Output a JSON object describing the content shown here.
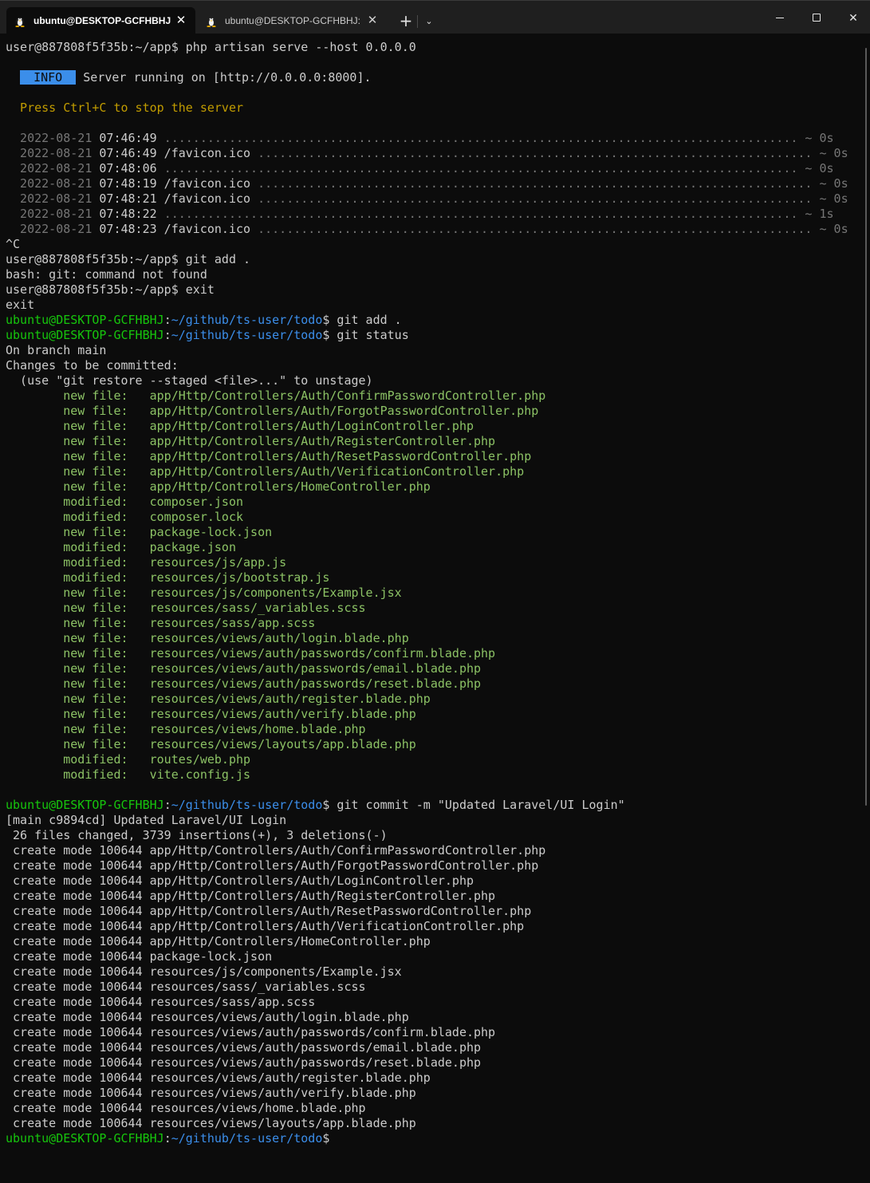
{
  "tabs": [
    {
      "title": "ubuntu@DESKTOP-GCFHBHJ:",
      "icon": "tux-icon",
      "active": true
    },
    {
      "title": "ubuntu@DESKTOP-GCFHBHJ: -",
      "icon": "tux-icon",
      "active": false
    }
  ],
  "titlebar": {
    "new_tab": "+",
    "dropdown": "⌄",
    "close_tab": "✕",
    "window_close": "✕"
  },
  "colors": {
    "background": "#0c0c0c",
    "prompt_green": "#16c60c",
    "path_blue": "#3b8eea",
    "git_green": "#8cc265",
    "warning_yellow": "#c19c00",
    "info_badge": "#3b8eea"
  },
  "terminal": {
    "lines": [
      [
        {
          "t": "user@887808f5f35b:~/app$ php artisan serve --host 0.0.0.0",
          "c": "default"
        }
      ],
      [
        {
          "t": "",
          "c": "default"
        }
      ],
      [
        {
          "t": "  ",
          "c": "default"
        },
        {
          "t": " INFO ",
          "c": "badge"
        },
        {
          "t": " Server running on [http://0.0.0.0:8000].",
          "c": "default"
        }
      ],
      [
        {
          "t": "",
          "c": "default"
        }
      ],
      [
        {
          "t": "  Press Ctrl+C to stop the server",
          "c": "yellow"
        }
      ],
      [
        {
          "t": "",
          "c": "default"
        }
      ],
      [
        {
          "t": "  2022-08-21 ",
          "c": "gray"
        },
        {
          "t": "07:46:49 ",
          "c": "default"
        },
        {
          "t": "........................................................................................ ~ 0s",
          "c": "gray"
        }
      ],
      [
        {
          "t": "  2022-08-21 ",
          "c": "gray"
        },
        {
          "t": "07:46:49 /favicon.ico ",
          "c": "default"
        },
        {
          "t": "............................................................................. ~ 0s",
          "c": "gray"
        }
      ],
      [
        {
          "t": "  2022-08-21 ",
          "c": "gray"
        },
        {
          "t": "07:48:06 ",
          "c": "default"
        },
        {
          "t": "........................................................................................ ~ 0s",
          "c": "gray"
        }
      ],
      [
        {
          "t": "  2022-08-21 ",
          "c": "gray"
        },
        {
          "t": "07:48:19 /favicon.ico ",
          "c": "default"
        },
        {
          "t": "............................................................................. ~ 0s",
          "c": "gray"
        }
      ],
      [
        {
          "t": "  2022-08-21 ",
          "c": "gray"
        },
        {
          "t": "07:48:21 /favicon.ico ",
          "c": "default"
        },
        {
          "t": "............................................................................. ~ 0s",
          "c": "gray"
        }
      ],
      [
        {
          "t": "  2022-08-21 ",
          "c": "gray"
        },
        {
          "t": "07:48:22 ",
          "c": "default"
        },
        {
          "t": "........................................................................................ ~ 1s",
          "c": "gray"
        }
      ],
      [
        {
          "t": "  2022-08-21 ",
          "c": "gray"
        },
        {
          "t": "07:48:23 /favicon.ico ",
          "c": "default"
        },
        {
          "t": "............................................................................. ~ 0s",
          "c": "gray"
        }
      ],
      [
        {
          "t": "^C",
          "c": "default"
        }
      ],
      [
        {
          "t": "user@887808f5f35b:~/app$ git add .",
          "c": "default"
        }
      ],
      [
        {
          "t": "bash: git: command not found",
          "c": "default"
        }
      ],
      [
        {
          "t": "user@887808f5f35b:~/app$ exit",
          "c": "default"
        }
      ],
      [
        {
          "t": "exit",
          "c": "default"
        }
      ],
      [
        {
          "t": "ubuntu@DESKTOP-GCFHBHJ",
          "c": "prompt"
        },
        {
          "t": ":",
          "c": "default"
        },
        {
          "t": "~/github/ts-user/todo",
          "c": "path"
        },
        {
          "t": "$ git add .",
          "c": "default"
        }
      ],
      [
        {
          "t": "ubuntu@DESKTOP-GCFHBHJ",
          "c": "prompt"
        },
        {
          "t": ":",
          "c": "default"
        },
        {
          "t": "~/github/ts-user/todo",
          "c": "path"
        },
        {
          "t": "$ git status",
          "c": "default"
        }
      ],
      [
        {
          "t": "On branch main",
          "c": "default"
        }
      ],
      [
        {
          "t": "Changes to be committed:",
          "c": "default"
        }
      ],
      [
        {
          "t": "  (use \"git restore --staged <file>...\" to unstage)",
          "c": "default"
        }
      ],
      [
        {
          "t": "        new file:   app/Http/Controllers/Auth/ConfirmPasswordController.php",
          "c": "git"
        }
      ],
      [
        {
          "t": "        new file:   app/Http/Controllers/Auth/ForgotPasswordController.php",
          "c": "git"
        }
      ],
      [
        {
          "t": "        new file:   app/Http/Controllers/Auth/LoginController.php",
          "c": "git"
        }
      ],
      [
        {
          "t": "        new file:   app/Http/Controllers/Auth/RegisterController.php",
          "c": "git"
        }
      ],
      [
        {
          "t": "        new file:   app/Http/Controllers/Auth/ResetPasswordController.php",
          "c": "git"
        }
      ],
      [
        {
          "t": "        new file:   app/Http/Controllers/Auth/VerificationController.php",
          "c": "git"
        }
      ],
      [
        {
          "t": "        new file:   app/Http/Controllers/HomeController.php",
          "c": "git"
        }
      ],
      [
        {
          "t": "        modified:   composer.json",
          "c": "git"
        }
      ],
      [
        {
          "t": "        modified:   composer.lock",
          "c": "git"
        }
      ],
      [
        {
          "t": "        new file:   package-lock.json",
          "c": "git"
        }
      ],
      [
        {
          "t": "        modified:   package.json",
          "c": "git"
        }
      ],
      [
        {
          "t": "        modified:   resources/js/app.js",
          "c": "git"
        }
      ],
      [
        {
          "t": "        modified:   resources/js/bootstrap.js",
          "c": "git"
        }
      ],
      [
        {
          "t": "        new file:   resources/js/components/Example.jsx",
          "c": "git"
        }
      ],
      [
        {
          "t": "        new file:   resources/sass/_variables.scss",
          "c": "git"
        }
      ],
      [
        {
          "t": "        new file:   resources/sass/app.scss",
          "c": "git"
        }
      ],
      [
        {
          "t": "        new file:   resources/views/auth/login.blade.php",
          "c": "git"
        }
      ],
      [
        {
          "t": "        new file:   resources/views/auth/passwords/confirm.blade.php",
          "c": "git"
        }
      ],
      [
        {
          "t": "        new file:   resources/views/auth/passwords/email.blade.php",
          "c": "git"
        }
      ],
      [
        {
          "t": "        new file:   resources/views/auth/passwords/reset.blade.php",
          "c": "git"
        }
      ],
      [
        {
          "t": "        new file:   resources/views/auth/register.blade.php",
          "c": "git"
        }
      ],
      [
        {
          "t": "        new file:   resources/views/auth/verify.blade.php",
          "c": "git"
        }
      ],
      [
        {
          "t": "        new file:   resources/views/home.blade.php",
          "c": "git"
        }
      ],
      [
        {
          "t": "        new file:   resources/views/layouts/app.blade.php",
          "c": "git"
        }
      ],
      [
        {
          "t": "        modified:   routes/web.php",
          "c": "git"
        }
      ],
      [
        {
          "t": "        modified:   vite.config.js",
          "c": "git"
        }
      ],
      [
        {
          "t": "",
          "c": "default"
        }
      ],
      [
        {
          "t": "ubuntu@DESKTOP-GCFHBHJ",
          "c": "prompt"
        },
        {
          "t": ":",
          "c": "default"
        },
        {
          "t": "~/github/ts-user/todo",
          "c": "path"
        },
        {
          "t": "$ git commit -m \"Updated Laravel/UI Login\"",
          "c": "default"
        }
      ],
      [
        {
          "t": "[main c9894cd] Updated Laravel/UI Login",
          "c": "default"
        }
      ],
      [
        {
          "t": " 26 files changed, 3739 insertions(+), 3 deletions(-)",
          "c": "default"
        }
      ],
      [
        {
          "t": " create mode 100644 app/Http/Controllers/Auth/ConfirmPasswordController.php",
          "c": "default"
        }
      ],
      [
        {
          "t": " create mode 100644 app/Http/Controllers/Auth/ForgotPasswordController.php",
          "c": "default"
        }
      ],
      [
        {
          "t": " create mode 100644 app/Http/Controllers/Auth/LoginController.php",
          "c": "default"
        }
      ],
      [
        {
          "t": " create mode 100644 app/Http/Controllers/Auth/RegisterController.php",
          "c": "default"
        }
      ],
      [
        {
          "t": " create mode 100644 app/Http/Controllers/Auth/ResetPasswordController.php",
          "c": "default"
        }
      ],
      [
        {
          "t": " create mode 100644 app/Http/Controllers/Auth/VerificationController.php",
          "c": "default"
        }
      ],
      [
        {
          "t": " create mode 100644 app/Http/Controllers/HomeController.php",
          "c": "default"
        }
      ],
      [
        {
          "t": " create mode 100644 package-lock.json",
          "c": "default"
        }
      ],
      [
        {
          "t": " create mode 100644 resources/js/components/Example.jsx",
          "c": "default"
        }
      ],
      [
        {
          "t": " create mode 100644 resources/sass/_variables.scss",
          "c": "default"
        }
      ],
      [
        {
          "t": " create mode 100644 resources/sass/app.scss",
          "c": "default"
        }
      ],
      [
        {
          "t": " create mode 100644 resources/views/auth/login.blade.php",
          "c": "default"
        }
      ],
      [
        {
          "t": " create mode 100644 resources/views/auth/passwords/confirm.blade.php",
          "c": "default"
        }
      ],
      [
        {
          "t": " create mode 100644 resources/views/auth/passwords/email.blade.php",
          "c": "default"
        }
      ],
      [
        {
          "t": " create mode 100644 resources/views/auth/passwords/reset.blade.php",
          "c": "default"
        }
      ],
      [
        {
          "t": " create mode 100644 resources/views/auth/register.blade.php",
          "c": "default"
        }
      ],
      [
        {
          "t": " create mode 100644 resources/views/auth/verify.blade.php",
          "c": "default"
        }
      ],
      [
        {
          "t": " create mode 100644 resources/views/home.blade.php",
          "c": "default"
        }
      ],
      [
        {
          "t": " create mode 100644 resources/views/layouts/app.blade.php",
          "c": "default"
        }
      ],
      [
        {
          "t": "ubuntu@DESKTOP-GCFHBHJ",
          "c": "prompt"
        },
        {
          "t": ":",
          "c": "default"
        },
        {
          "t": "~/github/ts-user/todo",
          "c": "path"
        },
        {
          "t": "$",
          "c": "default"
        }
      ]
    ]
  }
}
